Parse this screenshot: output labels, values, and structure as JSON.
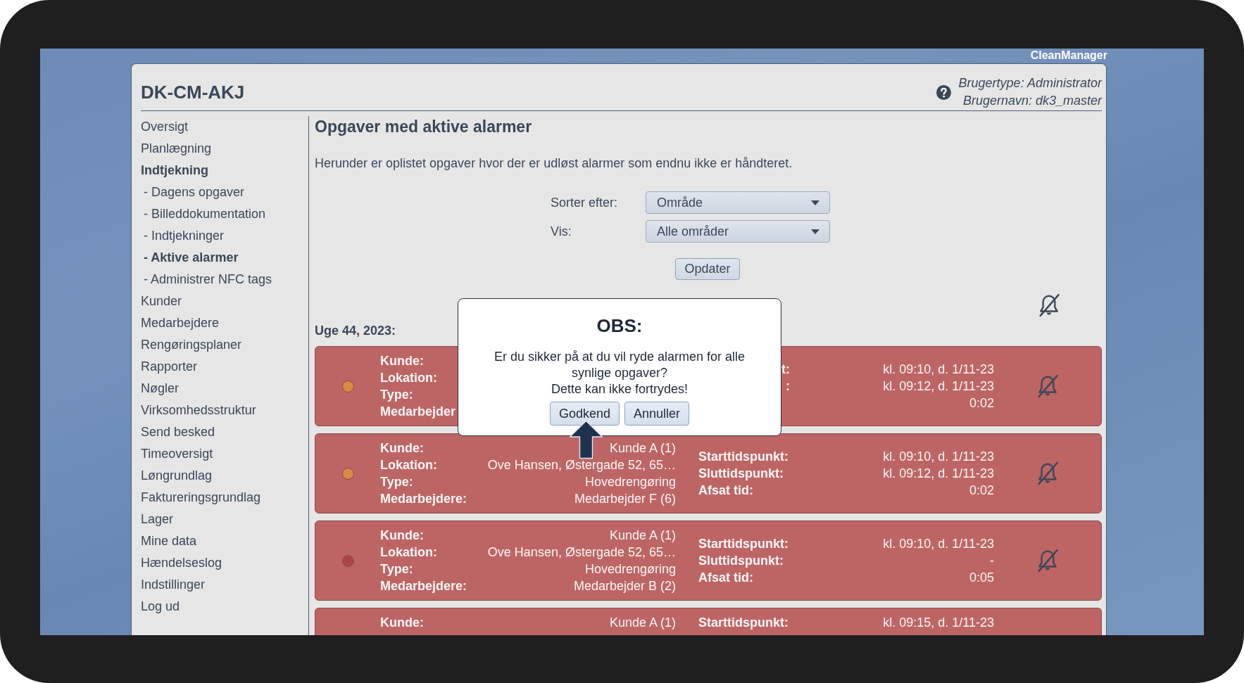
{
  "brand": "CleanManager",
  "header": {
    "title": "DK-CM-AKJ",
    "user_type": "Brugertype: Administrator",
    "user_name": "Brugernavn: dk3_master"
  },
  "sidebar": {
    "items": [
      {
        "label": "Oversigt",
        "selected": false
      },
      {
        "label": "Planlægning",
        "selected": false
      },
      {
        "label": "Indtjekning",
        "selected": true,
        "children": [
          {
            "label": "- Dagens opgaver",
            "selected": false
          },
          {
            "label": "- Billeddokumentation",
            "selected": false
          },
          {
            "label": "- Indtjekninger",
            "selected": false
          },
          {
            "label": "- Aktive alarmer",
            "selected": true
          },
          {
            "label": "- Administrer NFC tags",
            "selected": false
          }
        ]
      },
      {
        "label": "Kunder",
        "selected": false
      },
      {
        "label": "Medarbejdere",
        "selected": false
      },
      {
        "label": "Rengøringsplaner",
        "selected": false
      },
      {
        "label": "Rapporter",
        "selected": false
      },
      {
        "label": "Nøgler",
        "selected": false
      },
      {
        "label": "Virksomhedsstruktur",
        "selected": false
      },
      {
        "label": "Send besked",
        "selected": false
      },
      {
        "label": "Timeoversigt",
        "selected": false
      },
      {
        "label": "Løngrundlag",
        "selected": false
      },
      {
        "label": "Faktureringsgrundlag",
        "selected": false
      },
      {
        "label": "Lager",
        "selected": false
      },
      {
        "label": "Mine data",
        "selected": false
      },
      {
        "label": "Hændelseslog",
        "selected": false
      },
      {
        "label": "Indstillinger",
        "selected": false
      },
      {
        "label": "Log ud",
        "selected": false
      }
    ]
  },
  "page": {
    "title": "Opgaver med aktive alarmer",
    "description": "Herunder er oplistet opgaver hvor der er udløst alarmer som endnu ikke er håndteret.",
    "filters": [
      {
        "label": "Sorter efter:",
        "value": "Område"
      },
      {
        "label": "Vis:",
        "value": "Alle områder"
      }
    ],
    "update_button": "Opdater",
    "week_heading": "Uge 44, 2023:",
    "tasks": [
      {
        "kind": "covered",
        "color": "#d98a45",
        "details": [
          {
            "label": "Kunde:"
          },
          {
            "label": "Lokation:"
          },
          {
            "label": "Type:"
          },
          {
            "label": "Medarbejder"
          }
        ],
        "times": [
          {
            "label": "t:",
            "value": "kl. 09:10, d. 1/11-23"
          },
          {
            "label": ":",
            "value": "kl. 09:12, d. 1/11-23"
          },
          {
            "value": "0:02"
          }
        ]
      },
      {
        "kind": "full",
        "color": "#d98a45",
        "details": [
          {
            "label": "Kunde:",
            "value": "Kunde A (1)"
          },
          {
            "label": "Lokation:",
            "value": "Ove Hansen, Østergade 52, 65…"
          },
          {
            "label": "Type:",
            "value": "Hovedrengøring"
          },
          {
            "label": "Medarbejdere:",
            "value": "Medarbejder F (6)"
          }
        ],
        "times": [
          {
            "label": "Starttidspunkt:",
            "value": "kl. 09:10, d. 1/11-23"
          },
          {
            "label": "Sluttidspunkt:",
            "value": "kl. 09:12, d. 1/11-23"
          },
          {
            "label": "Afsat tid:",
            "value": "0:02"
          }
        ]
      },
      {
        "kind": "full",
        "color": "#a84649",
        "details": [
          {
            "label": "Kunde:",
            "value": "Kunde A (1)"
          },
          {
            "label": "Lokation:",
            "value": "Ove Hansen, Østergade 52, 65…"
          },
          {
            "label": "Type:",
            "value": "Hovedrengøring"
          },
          {
            "label": "Medarbejdere:",
            "value": "Medarbejder B (2)"
          }
        ],
        "times": [
          {
            "label": "Starttidspunkt:",
            "value": "kl. 09:10, d. 1/11-23"
          },
          {
            "label": "Sluttidspunkt:",
            "value": "-"
          },
          {
            "label": "Afsat tid:",
            "value": "0:05"
          }
        ]
      },
      {
        "kind": "cut",
        "details": [
          {
            "label": "Kunde:",
            "value": "Kunde A (1)"
          }
        ],
        "times": [
          {
            "label": "Starttidspunkt:",
            "value": "kl. 09:15, d. 1/11-23"
          }
        ]
      }
    ]
  },
  "dialog": {
    "title": "OBS:",
    "message_lines": [
      "Er du sikker på at du vil ryde alarmen for alle synlige opgaver?",
      "Dette kan ikke fortrydes!"
    ],
    "buttons": [
      "Godkend",
      "Annuller"
    ]
  }
}
